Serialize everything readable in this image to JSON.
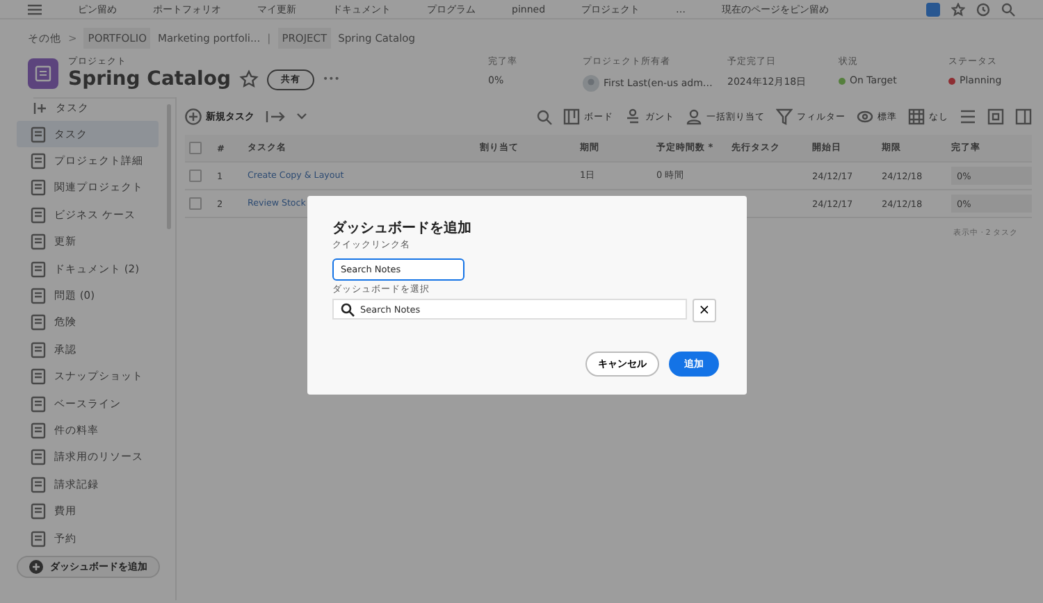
{
  "top_nav": [
    "ピン留め",
    "ポートフォリオ",
    "マイ更新",
    "ドキュメント",
    "プログラム",
    "pinned",
    "プロジェクト",
    "…",
    "現在のページをピン留め"
  ],
  "breadcrumb": [
    {
      "kind": "text",
      "label": "その他"
    },
    {
      "kind": "sep",
      "label": ">"
    },
    {
      "kind": "tag",
      "label": "PORTFOLIO"
    },
    {
      "kind": "text",
      "label": "Marketing portfoli..."
    },
    {
      "kind": "sep",
      "label": "|"
    },
    {
      "kind": "tag",
      "label": "PROJECT"
    },
    {
      "kind": "text",
      "label": "Spring Catalog"
    }
  ],
  "header": {
    "eyebrow": "プロジェクト",
    "title": "Spring Catalog",
    "share": "共有",
    "more": "•••",
    "fields": [
      {
        "label": "完了率",
        "value": "0%",
        "kind": "text"
      },
      {
        "label": "プロジェクト所有者",
        "value": "First Last(en-us adm…",
        "kind": "avatar"
      },
      {
        "label": "予定完了日",
        "value": "2024年12月18日",
        "kind": "text"
      },
      {
        "label": "状況",
        "value": "On Target",
        "kind": "ok"
      },
      {
        "label": "ステータス",
        "value": "Planning",
        "kind": "alert"
      }
    ]
  },
  "sidebar": {
    "heading": "タスク",
    "items": [
      {
        "label": "タスク",
        "selected": true
      },
      {
        "label": "プロジェクト詳細",
        "selected": false
      },
      {
        "label": "関連プロジェクト",
        "selected": false
      },
      {
        "label": "ビジネス ケース",
        "selected": false
      },
      {
        "label": "更新",
        "selected": false
      },
      {
        "label": "ドキュメント (2)",
        "selected": false
      },
      {
        "label": "問題 (0)",
        "selected": false
      },
      {
        "label": "危険",
        "selected": false
      },
      {
        "label": "承認",
        "selected": false
      },
      {
        "label": "スナップショット",
        "selected": false
      },
      {
        "label": "ベースライン",
        "selected": false
      },
      {
        "label": "件の料率",
        "selected": false
      },
      {
        "label": "請求用のリソース",
        "selected": false
      },
      {
        "label": "請求記録",
        "selected": false
      },
      {
        "label": "費用",
        "selected": false
      },
      {
        "label": "予約",
        "selected": false
      }
    ],
    "add_button": "ダッシュボードを追加"
  },
  "toolbar": {
    "new_task": "新規タスク",
    "tools": [
      "ボード",
      "ガント",
      "一括割り当て",
      "フィルター",
      "標準",
      "なし"
    ]
  },
  "table": {
    "columns": [
      "#",
      "タスク名",
      "割り当て",
      "期間",
      "予定時間数 *",
      "先行タスク",
      "開始日",
      "期限",
      "完了率"
    ],
    "all_checked": false,
    "rows": [
      {
        "cells": [
          "1",
          "Create Copy & Layout",
          "",
          "1日",
          "0 時間",
          "",
          "24/12/17",
          "24/12/18",
          "0%"
        ],
        "checked": false,
        "level": 0
      },
      {
        "cells": [
          "2",
          "Review Stock",
          "",
          "",
          "",
          "",
          "24/12/17",
          "24/12/18",
          "0%"
        ],
        "checked": false,
        "level": 0
      }
    ],
    "footer": "表示中 · 2 タスク"
  },
  "dialog": {
    "title": "ダッシュボードを追加",
    "name_label": "クイックリンク名",
    "name_value": "Search Notes",
    "select_label": "ダッシュボードを選択",
    "select_value": "Search Notes",
    "clear": "×",
    "cancel": "キャンセル",
    "confirm": "追加"
  }
}
